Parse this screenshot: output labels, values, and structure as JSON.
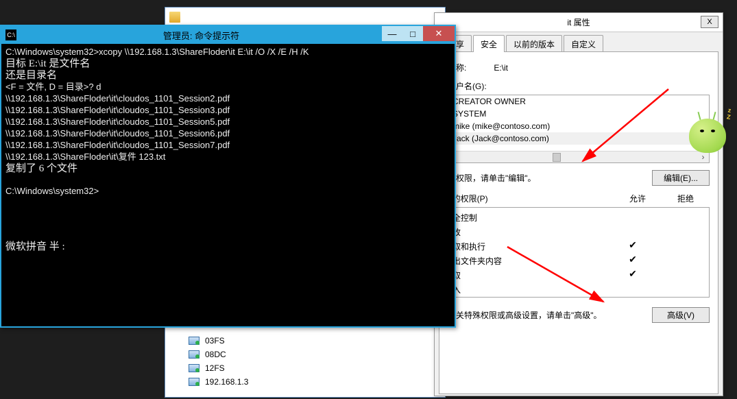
{
  "explorer": {
    "items": [
      {
        "label": "03FS"
      },
      {
        "label": "08DC"
      },
      {
        "label": "12FS"
      },
      {
        "label": "192.168.1.3"
      }
    ]
  },
  "cmd": {
    "title": "管理员: 命令提示符",
    "icon_text": "C:\\",
    "line_prompt1": "C:\\Windows\\system32>xcopy \\\\192.168.1.3\\ShareFloder\\it E:\\it /O /X /E /H /K",
    "line_target": "目标 E:\\it 是文件名",
    "line_ordir": "还是目录名",
    "line_choice": "<F = 文件, D = 目录>? d",
    "files": [
      "\\\\192.168.1.3\\ShareFloder\\it\\cloudos_1101_Session2.pdf",
      "\\\\192.168.1.3\\ShareFloder\\it\\cloudos_1101_Session3.pdf",
      "\\\\192.168.1.3\\ShareFloder\\it\\cloudos_1101_Session5.pdf",
      "\\\\192.168.1.3\\ShareFloder\\it\\cloudos_1101_Session6.pdf",
      "\\\\192.168.1.3\\ShareFloder\\it\\cloudos_1101_Session7.pdf",
      "\\\\192.168.1.3\\ShareFloder\\it\\复件 123.txt"
    ],
    "line_copied": "复制了 6 个文件",
    "line_prompt2": "C:\\Windows\\system32>",
    "ime": "微软拼音 半 :"
  },
  "prop": {
    "title": "it 属性",
    "close": "X",
    "tabs": {
      "share": "共享",
      "security": "安全",
      "prev": "以前的版本",
      "custom": "自定义"
    },
    "obj_label": "名称:",
    "obj_path": "E:\\it",
    "group_label": "用户名(G):",
    "users": [
      "CREATOR OWNER",
      "SYSTEM",
      "mike (mike@contoso.com)",
      "Jack (Jack@contoso.com)"
    ],
    "edit_hint": "改权限，请单击\"编辑\"。",
    "edit_btn": "编辑(E)...",
    "perm_label": ": 的权限(P)",
    "col_allow": "允许",
    "col_deny": "拒绝",
    "perms": [
      {
        "name": "全控制",
        "allow": false
      },
      {
        "name": "改",
        "allow": false
      },
      {
        "name": "取和执行",
        "allow": true
      },
      {
        "name": "出文件夹内容",
        "allow": true
      },
      {
        "name": "取",
        "allow": true
      },
      {
        "name": "入",
        "allow": false
      }
    ],
    "adv_hint": "有关特殊权限或高级设置，请单击\"高级\"。",
    "adv_btn": "高级(V)"
  },
  "mascot": {
    "zz": "Z",
    "zz2": "z"
  }
}
